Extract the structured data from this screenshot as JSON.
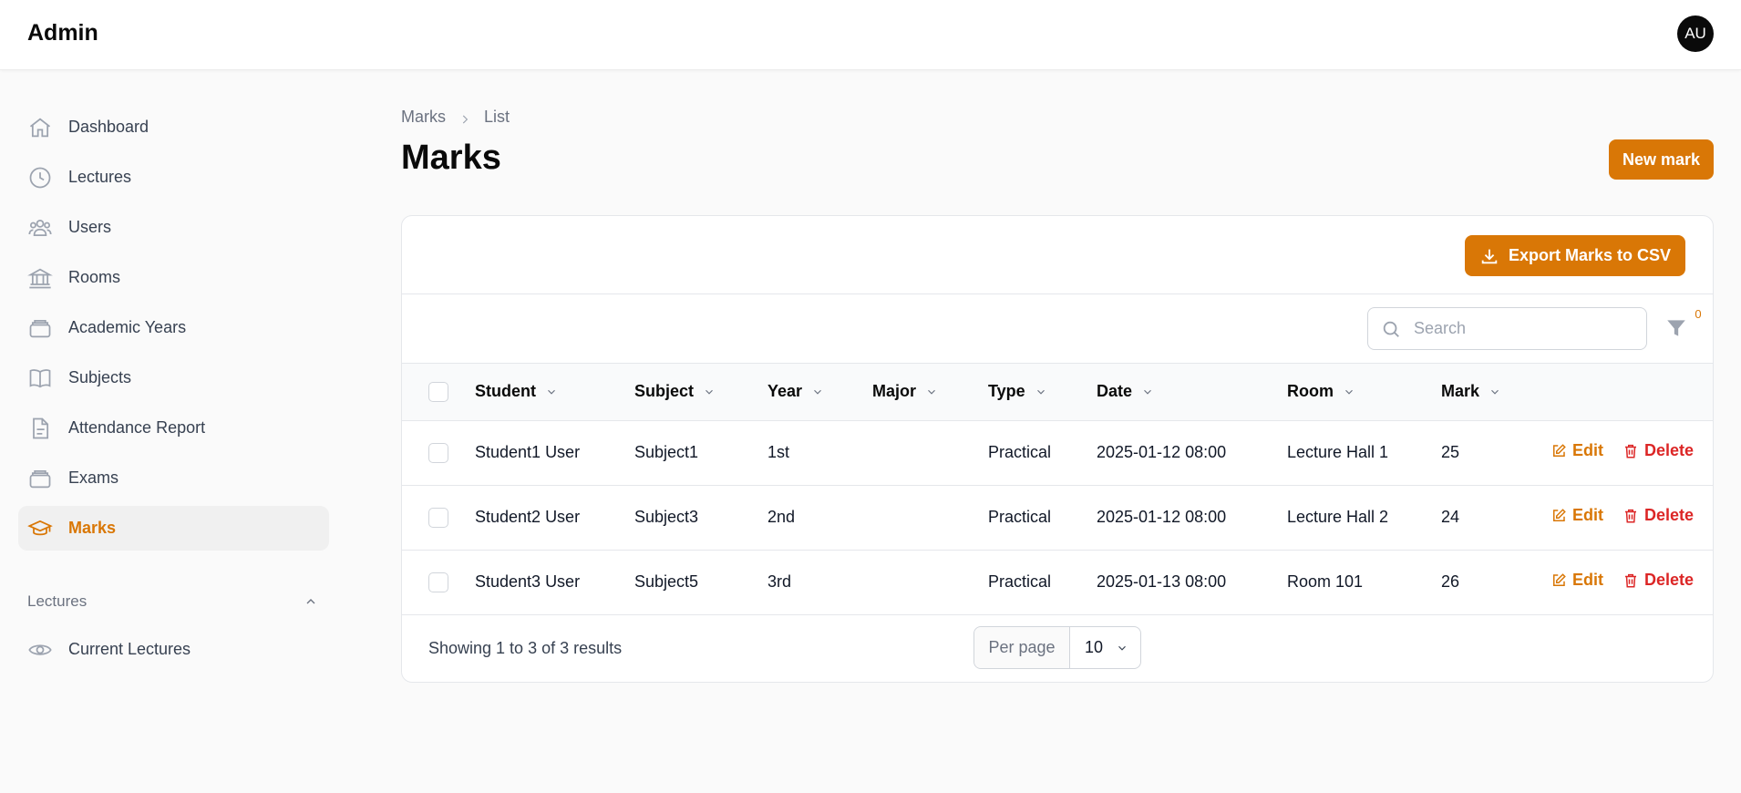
{
  "header": {
    "brand": "Admin",
    "avatar_initials": "AU"
  },
  "sidebar": {
    "items": [
      {
        "label": "Dashboard",
        "icon": "home-icon"
      },
      {
        "label": "Lectures",
        "icon": "clock-icon"
      },
      {
        "label": "Users",
        "icon": "users-icon"
      },
      {
        "label": "Rooms",
        "icon": "building-icon"
      },
      {
        "label": "Academic Years",
        "icon": "stack-icon"
      },
      {
        "label": "Subjects",
        "icon": "book-icon"
      },
      {
        "label": "Attendance Report",
        "icon": "document-icon"
      },
      {
        "label": "Exams",
        "icon": "stack-icon"
      },
      {
        "label": "Marks",
        "icon": "graduation-cap-icon",
        "active": true
      }
    ],
    "group": {
      "label": "Lectures",
      "icon": "chevron-up-icon",
      "items": [
        {
          "label": "Current Lectures",
          "icon": "eye-icon"
        }
      ]
    }
  },
  "breadcrumb": {
    "parent": "Marks",
    "current": "List"
  },
  "page": {
    "title": "Marks",
    "new_button": "New mark"
  },
  "card": {
    "export_button": "Export Marks to CSV"
  },
  "search": {
    "placeholder": "Search",
    "value": ""
  },
  "filter": {
    "badge_count": "0"
  },
  "table": {
    "columns": [
      "Student",
      "Subject",
      "Year",
      "Major",
      "Type",
      "Date",
      "Room",
      "Mark"
    ],
    "rows": [
      {
        "student": "Student1 User",
        "subject": "Subject1",
        "year": "1st",
        "major": "",
        "type": "Practical",
        "date": "2025-01-12 08:00",
        "room": "Lecture Hall 1",
        "mark": "25"
      },
      {
        "student": "Student2 User",
        "subject": "Subject3",
        "year": "2nd",
        "major": "",
        "type": "Practical",
        "date": "2025-01-12 08:00",
        "room": "Lecture Hall 2",
        "mark": "24"
      },
      {
        "student": "Student3 User",
        "subject": "Subject5",
        "year": "3rd",
        "major": "",
        "type": "Practical",
        "date": "2025-01-13 08:00",
        "room": "Room 101",
        "mark": "26"
      }
    ],
    "actions": {
      "edit": "Edit",
      "delete": "Delete"
    }
  },
  "pagination": {
    "summary": "Showing 1 to 3 of 3 results",
    "per_page_label": "Per page",
    "per_page_value": "10"
  },
  "colors": {
    "accent": "#d97706",
    "danger": "#dc2626"
  }
}
